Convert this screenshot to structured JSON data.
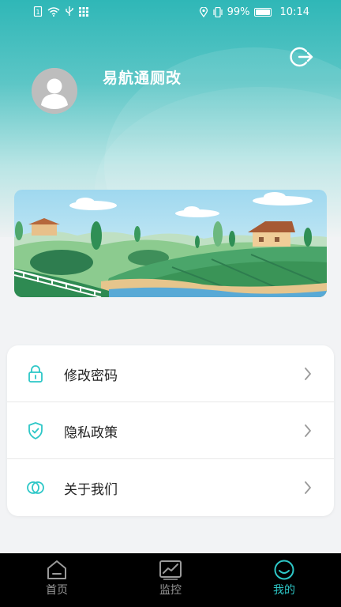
{
  "status_bar": {
    "battery": "99%",
    "time": "10:14"
  },
  "profile": {
    "username": "易航通厕改"
  },
  "menu": [
    {
      "label": "修改密码",
      "icon": "lock-icon"
    },
    {
      "label": "隐私政策",
      "icon": "shield-icon"
    },
    {
      "label": "关于我们",
      "icon": "about-icon"
    }
  ],
  "tabs": [
    {
      "label": "首页",
      "icon": "home-icon",
      "active": false
    },
    {
      "label": "监控",
      "icon": "monitor-chart-icon",
      "active": false
    },
    {
      "label": "我的",
      "icon": "profile-smile-icon",
      "active": true
    }
  ],
  "colors": {
    "accent": "#2dc7c7",
    "header_top": "#2fb7b7",
    "tab_inactive": "#9a9a9a"
  }
}
